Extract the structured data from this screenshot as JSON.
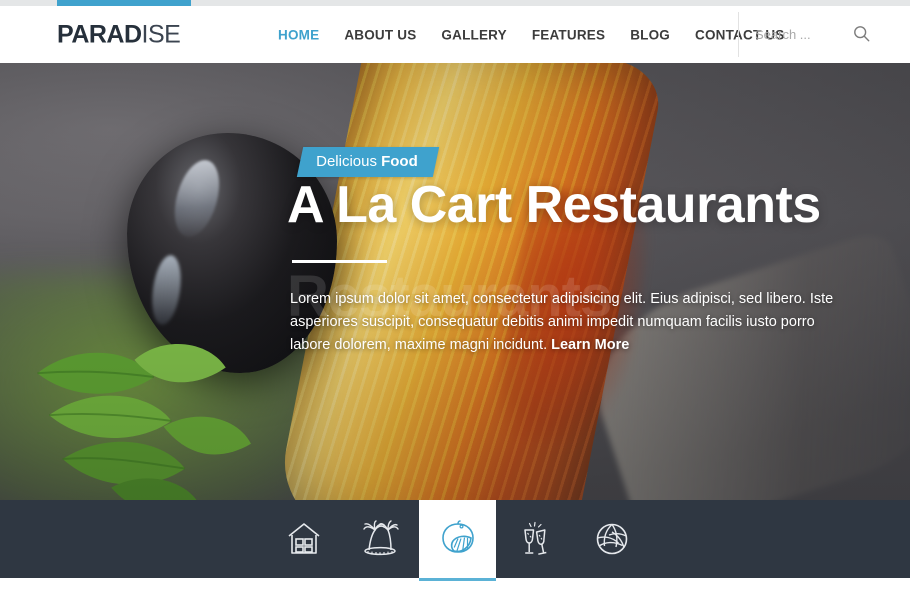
{
  "brand": {
    "name_bold": "PARAD",
    "name_light": "ISE"
  },
  "topbar": {
    "accent_color": "#3fa2cd",
    "track_color": "#e4e6e7"
  },
  "nav": {
    "items": [
      {
        "label": "HOME",
        "active": true
      },
      {
        "label": "ABOUT US",
        "active": false
      },
      {
        "label": "GALLERY",
        "active": false
      },
      {
        "label": "FEATURES",
        "active": false
      },
      {
        "label": "BLOG",
        "active": false
      },
      {
        "label": "CONTACT US",
        "active": false
      }
    ]
  },
  "search": {
    "placeholder": "Search ...",
    "value": "",
    "icon": "search-icon"
  },
  "hero": {
    "badge_regular": "Delicious",
    "badge_bold": "Food",
    "title": "A La Cart Restaurants",
    "ghost_title": "Restaurants",
    "paragraph": "Lorem ipsum dolor sit amet, consectetur adipisicing elit. Eius adipisci, sed libero. Iste asperiores suscipit, consequatur debitis animi impedit numquam facilis iusto porro labore dolorem, maxime magni incidunt. ",
    "learn_more": "Learn More",
    "badge_color": "#3fa2cd"
  },
  "iconbar": {
    "background": "#2f3742",
    "active_color": "#3fa2cd",
    "items": [
      {
        "icon": "house-icon",
        "label": "House",
        "active": false
      },
      {
        "icon": "palm-trees-icon",
        "label": "Palm Trees",
        "active": false
      },
      {
        "icon": "lemon-slice-icon",
        "label": "Lemon",
        "active": true
      },
      {
        "icon": "champagne-glasses-icon",
        "label": "Champagne",
        "active": false
      },
      {
        "icon": "volleyball-icon",
        "label": "Volleyball",
        "active": false
      }
    ]
  }
}
